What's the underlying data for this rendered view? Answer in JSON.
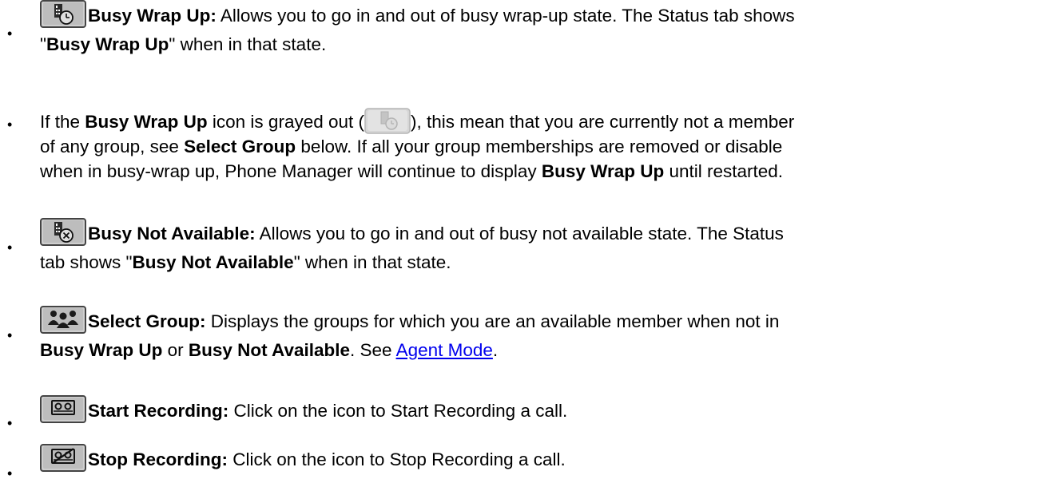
{
  "items": [
    {
      "icon": "busy-wrap-up-icon",
      "title": "Busy Wrap Up:",
      "line1": " Allows you to go in and out of busy wrap-up state. The Status tab shows",
      "line2_pre": "\"",
      "line2_bold": "Busy Wrap Up",
      "line2_post": "\" when in that state."
    },
    {
      "pre": "If the ",
      "bold1": "Busy Wrap Up",
      "mid1": " icon is grayed out (",
      "icon": "busy-wrap-up-grayed-icon",
      "mid2": "), this mean that you are currently not a member",
      "line2_pre": "of any group, see ",
      "line2_bold": "Select Group",
      "line2_post": " below. If all your group memberships are removed or disable",
      "line3_pre": "when in busy-wrap up, Phone Manager will continue to display ",
      "line3_bold": "Busy Wrap Up",
      "line3_post": " until restarted."
    },
    {
      "icon": "busy-not-available-icon",
      "title": "Busy Not Available:",
      "line1": " Allows you to go in and out of busy not available state. The Status",
      "line2_pre": "tab shows \"",
      "line2_bold": "Busy Not Available",
      "line2_post": "\" when in that state."
    },
    {
      "icon": "select-group-icon",
      "title": "Select Group:",
      "line1": " Displays the groups for which you are an available member when not in",
      "line2_bold1": "Busy Wrap Up",
      "line2_mid": " or ",
      "line2_bold2": "Busy Not Available",
      "line2_post": ". See ",
      "line2_link": "Agent Mode",
      "line2_end": "."
    },
    {
      "icon": "start-recording-icon",
      "title": "Start Recording:",
      "line1": " Click on the icon to Start Recording a call."
    },
    {
      "icon": "stop-recording-icon",
      "title": "Stop Recording:",
      "line1": " Click on the icon to Stop Recording a call."
    }
  ],
  "bullet_char": "•",
  "colors": {
    "text": "#000000",
    "link": "#0000ee",
    "icon_face": "#c9c9c9",
    "icon_border": "#4a4a4a"
  }
}
